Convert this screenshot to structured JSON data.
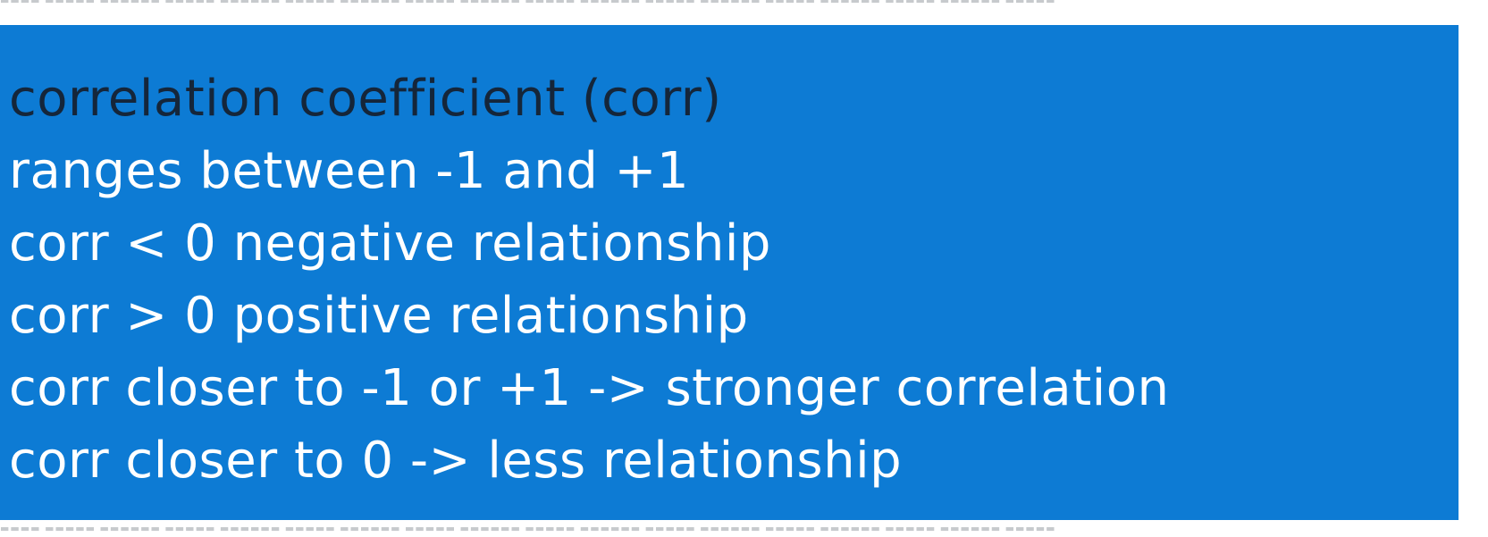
{
  "colors": {
    "overlay_background": "#0d7bd4",
    "heading_text": "#15263a",
    "body_text": "#ffffff",
    "page_background": "#ffffff"
  },
  "slide": {
    "heading": "correlation coefficient (corr)",
    "lines": [
      "ranges between -1 and +1",
      "corr < 0 negative relationship",
      "corr > 0 positive relationship",
      "corr closer to -1 or +1 -> stronger correlation",
      "corr closer to 0 -> less relationship"
    ]
  }
}
